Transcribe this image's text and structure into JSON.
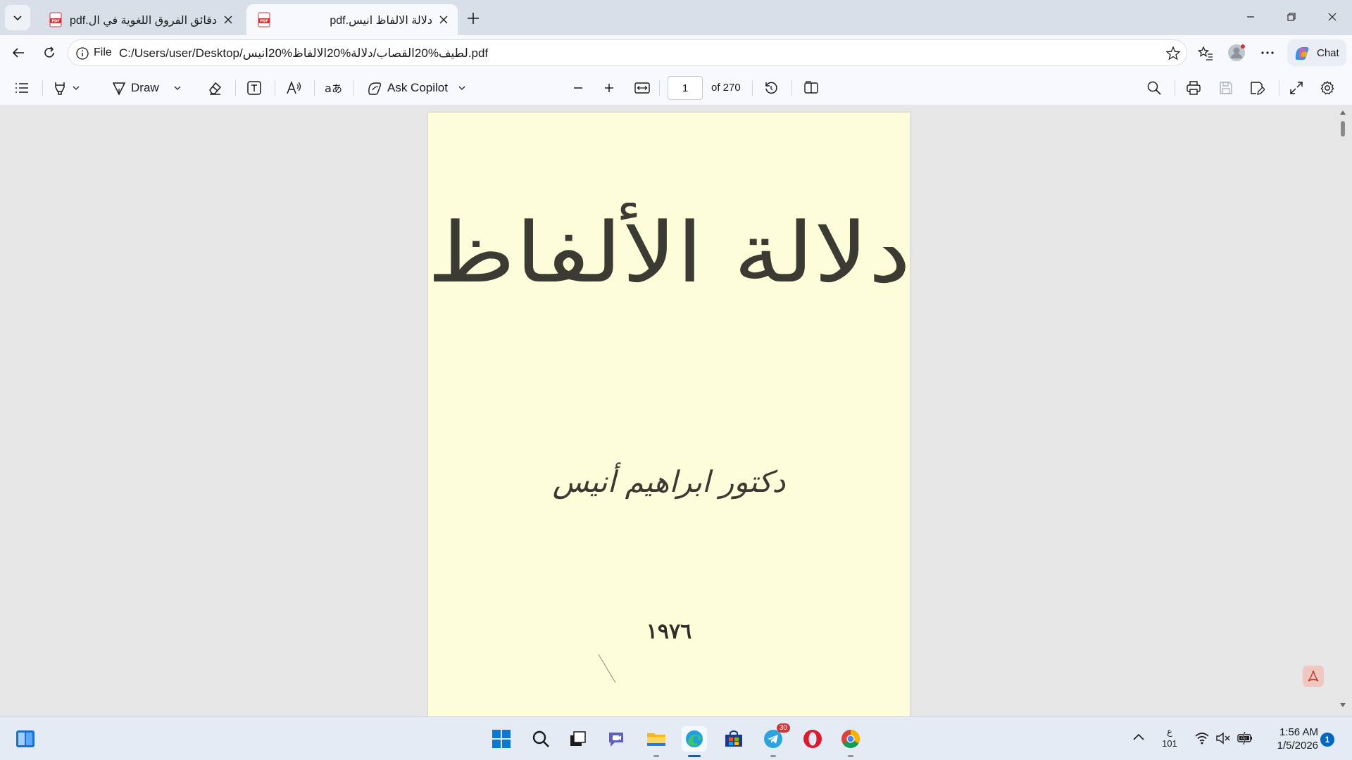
{
  "browser": {
    "tabs": [
      {
        "title": "دقائق الفروق اللغوية في ال.pdf",
        "active": false
      },
      {
        "title": "دلالة الالفاظ انيس.pdf",
        "active": true
      }
    ],
    "address": {
      "scheme": "File",
      "url": "C:/Users/user/Desktop/لطيف%20القصاب/دلالة%20الالفاظ%20انيس.pdf"
    },
    "chat_label": "Chat"
  },
  "pdf_toolbar": {
    "draw_label": "Draw",
    "copilot_label": "Ask Copilot",
    "page_current": "1",
    "page_total": "of 270"
  },
  "document": {
    "title": "دلالة الألفاظ",
    "author": "دكتور ابراهيم أنيس",
    "year": "١٩٧٦"
  },
  "taskbar": {
    "telegram_badge": "30",
    "ime_line1": "ع",
    "ime_line2": "101",
    "time": "1:56 AM",
    "date": "1/5/2026",
    "notification_count": "1"
  },
  "colors": {
    "accent": "#0067c0",
    "page_background": "#fefdda",
    "viewer_background": "#e6e6e6"
  }
}
